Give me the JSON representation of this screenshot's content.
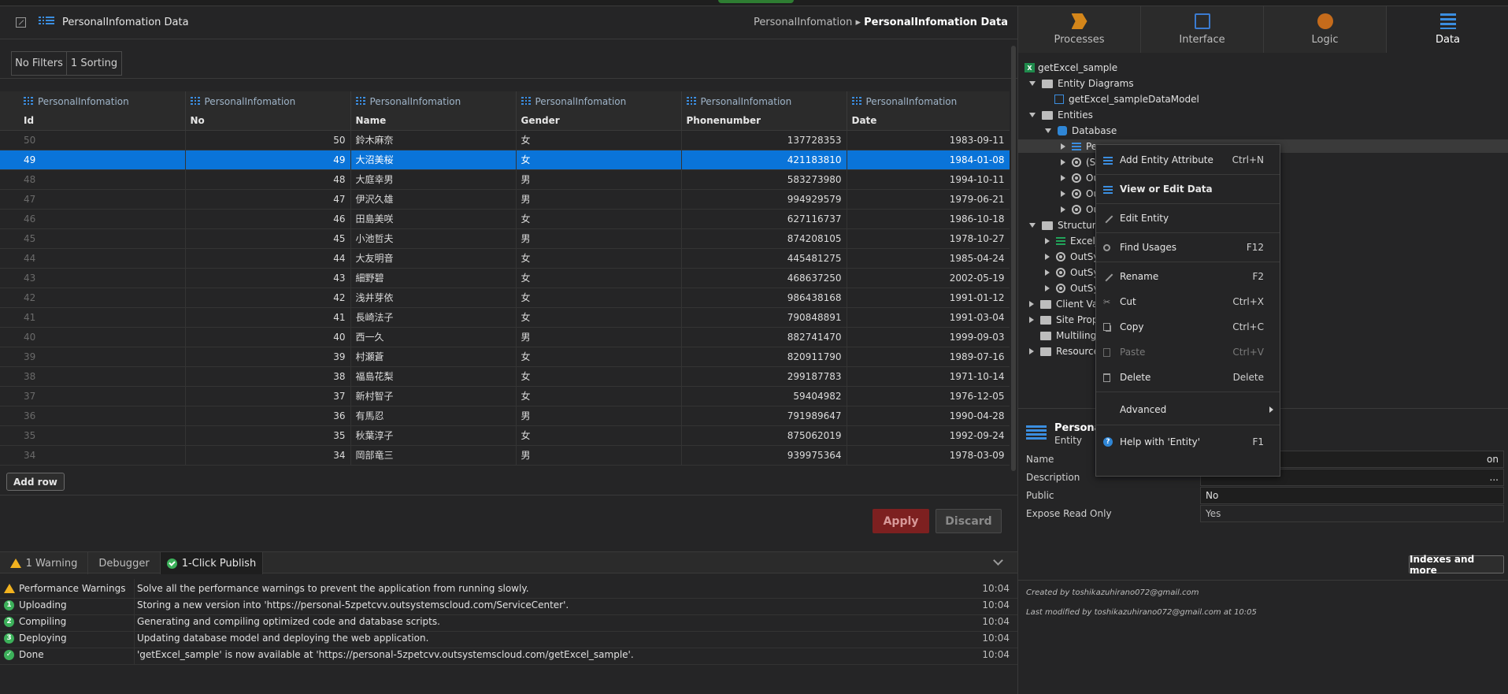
{
  "editor": {
    "title": "PersonalInfomation Data",
    "breadcrumb_parent": "PersonalInfomation",
    "breadcrumb_sep": "▸",
    "breadcrumb_current": "PersonalInfomation Data"
  },
  "filters": {
    "no_filters": "No Filters",
    "sorting": "1 Sorting"
  },
  "grid": {
    "columns": [
      {
        "entity": "PersonalInfomation",
        "name": "Id"
      },
      {
        "entity": "PersonalInfomation",
        "name": "No"
      },
      {
        "entity": "PersonalInfomation",
        "name": "Name"
      },
      {
        "entity": "PersonalInfomation",
        "name": "Gender"
      },
      {
        "entity": "PersonalInfomation",
        "name": "Phonenumber"
      },
      {
        "entity": "PersonalInfomation",
        "name": "Date"
      }
    ],
    "rows": [
      {
        "id": "50",
        "no": "50",
        "name": "鈴木麻奈",
        "gender": "女",
        "phone": "137728353",
        "date": "1983-09-11"
      },
      {
        "id": "49",
        "no": "49",
        "name": "大沼美桜",
        "gender": "女",
        "phone": "421183810",
        "date": "1984-01-08"
      },
      {
        "id": "48",
        "no": "48",
        "name": "大庭幸男",
        "gender": "男",
        "phone": "583273980",
        "date": "1994-10-11"
      },
      {
        "id": "47",
        "no": "47",
        "name": "伊沢久雄",
        "gender": "男",
        "phone": "994929579",
        "date": "1979-06-21"
      },
      {
        "id": "46",
        "no": "46",
        "name": "田島美咲",
        "gender": "女",
        "phone": "627116737",
        "date": "1986-10-18"
      },
      {
        "id": "45",
        "no": "45",
        "name": "小池哲夫",
        "gender": "男",
        "phone": "874208105",
        "date": "1978-10-27"
      },
      {
        "id": "44",
        "no": "44",
        "name": "大友明音",
        "gender": "女",
        "phone": "445481275",
        "date": "1985-04-24"
      },
      {
        "id": "43",
        "no": "43",
        "name": "細野碧",
        "gender": "女",
        "phone": "468637250",
        "date": "2002-05-19"
      },
      {
        "id": "42",
        "no": "42",
        "name": "浅井芽依",
        "gender": "女",
        "phone": "986438168",
        "date": "1991-01-12"
      },
      {
        "id": "41",
        "no": "41",
        "name": "長崎法子",
        "gender": "女",
        "phone": "790848891",
        "date": "1991-03-04"
      },
      {
        "id": "40",
        "no": "40",
        "name": "西一久",
        "gender": "男",
        "phone": "882741470",
        "date": "1999-09-03"
      },
      {
        "id": "39",
        "no": "39",
        "name": "村瀬蒼",
        "gender": "女",
        "phone": "820911790",
        "date": "1989-07-16"
      },
      {
        "id": "38",
        "no": "38",
        "name": "福島花梨",
        "gender": "女",
        "phone": "299187783",
        "date": "1971-10-14"
      },
      {
        "id": "37",
        "no": "37",
        "name": "新村智子",
        "gender": "女",
        "phone": "59404982",
        "date": "1976-12-05"
      },
      {
        "id": "36",
        "no": "36",
        "name": "有馬忍",
        "gender": "男",
        "phone": "791989647",
        "date": "1990-04-28"
      },
      {
        "id": "35",
        "no": "35",
        "name": "秋葉淳子",
        "gender": "女",
        "phone": "875062019",
        "date": "1992-09-24"
      },
      {
        "id": "34",
        "no": "34",
        "name": "岡部竜三",
        "gender": "男",
        "phone": "939975364",
        "date": "1978-03-09"
      }
    ]
  },
  "actions": {
    "add_row": "Add row",
    "apply": "Apply",
    "discard": "Discard"
  },
  "bottom_tabs": {
    "warning": "1 Warning",
    "debugger": "Debugger",
    "publish": "1-Click Publish"
  },
  "log": [
    {
      "icon": "!",
      "name": "Performance Warnings",
      "message": "Solve all the performance warnings to prevent the application from running slowly.",
      "time": "10:04"
    },
    {
      "icon": "1",
      "name": "Uploading",
      "message": "Storing a new version into 'https://personal-5zpetcvv.outsystemscloud.com/ServiceCenter'.",
      "time": "10:04"
    },
    {
      "icon": "2",
      "name": "Compiling",
      "message": "Generating and compiling optimized code and database scripts.",
      "time": "10:04"
    },
    {
      "icon": "3",
      "name": "Deploying",
      "message": "Updating database model and deploying the web application.",
      "time": "10:04"
    },
    {
      "icon": "✓",
      "name": "Done",
      "message": "'getExcel_sample' is now available at 'https://personal-5zpetcvv.outsystemscloud.com/getExcel_sample'.",
      "time": "10:04"
    }
  ],
  "right_tabs": {
    "processes": "Processes",
    "interface": "Interface",
    "logic": "Logic",
    "data": "Data"
  },
  "tree": {
    "root": "getExcel_sample",
    "entity_diagrams": "Entity Diagrams",
    "diagram_model": "getExcel_sampleDataModel",
    "entities": "Entities",
    "database": "Database",
    "ent1": "Pe",
    "ent2": "(S",
    "ent3": "Ou",
    "ent4": "Ou",
    "ent5": "Ou",
    "structures": "Structure",
    "struct1": "Excel_",
    "struct2": "OutSy",
    "struct3": "OutSy",
    "struct4": "OutSy",
    "client_vars": "Client Var",
    "site_props": "Site Prope",
    "multilingual": "Multilingu",
    "resources": "Resource",
    "xls_label": "X"
  },
  "props": {
    "entity_name": "Personal",
    "entity_type": "Entity",
    "name_label": "Name",
    "name_value": "on",
    "description_label": "Description",
    "description_value": "...",
    "public_label": "Public",
    "public_value": "No",
    "expose_label": "Expose Read Only",
    "expose_value": "Yes",
    "indexes_button": "Indexes and more",
    "created_by": "Created by toshikazuhirano072@gmail.com",
    "modified_by": "Last modified by toshikazuhirano072@gmail.com at 10:05"
  },
  "context_menu": {
    "add_attr": "Add Entity Attribute",
    "add_attr_sc": "Ctrl+N",
    "view_edit": "View or Edit Data",
    "edit_entity": "Edit Entity",
    "find_usages": "Find Usages",
    "find_usages_sc": "F12",
    "rename": "Rename",
    "rename_sc": "F2",
    "cut": "Cut",
    "cut_sc": "Ctrl+X",
    "copy": "Copy",
    "copy_sc": "Ctrl+C",
    "paste": "Paste",
    "paste_sc": "Ctrl+V",
    "delete": "Delete",
    "delete_sc": "Delete",
    "advanced": "Advanced",
    "help": "Help with 'Entity'",
    "help_sc": "F1",
    "help_icon": "?",
    "cut_icon": "✂"
  }
}
